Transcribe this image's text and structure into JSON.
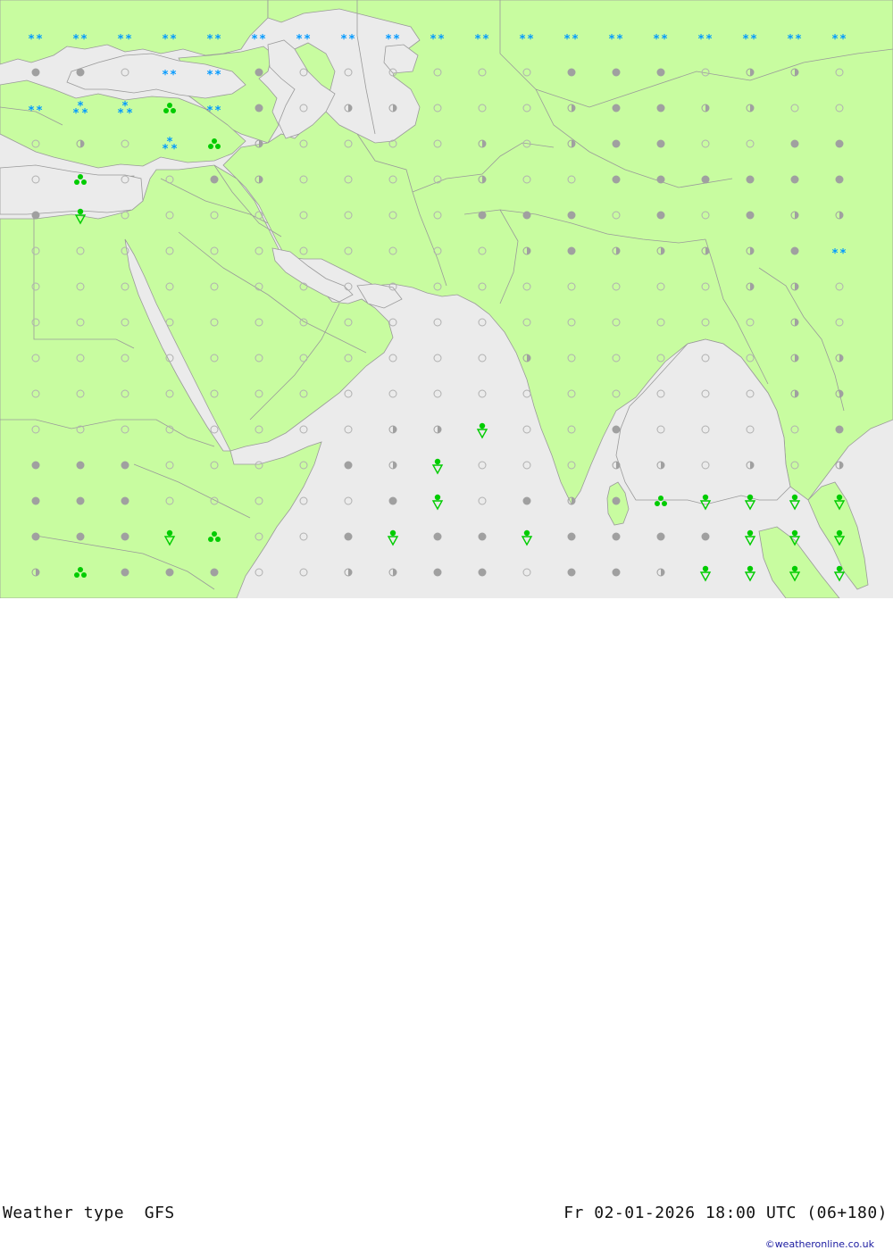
{
  "title": {
    "product": "Weather type",
    "model": "GFS",
    "datetime": "Fr 02-01-2026 18:00 UTC (06+180)"
  },
  "credit": "©weatheronline.co.uk",
  "colors": {
    "sea": "#ebebeb",
    "land": "#c8fca0",
    "border": "#9a9a9a",
    "dot_gray": "#a0a0a0",
    "rain_green": "#00cc00",
    "snow_blue": "#0099ff"
  },
  "symbols": {
    "column_x": [
      40,
      90,
      140,
      190,
      240,
      290,
      340,
      390,
      440,
      490,
      540,
      590,
      640,
      690,
      740,
      790,
      840,
      890,
      940
    ],
    "row_y": [
      41,
      81,
      121,
      161,
      201,
      241,
      281,
      321,
      361,
      401,
      441,
      481,
      521,
      561,
      601,
      641
    ],
    "grid": [
      "s.d.s.d.s.d.s.d.s.d.s.d.s.d.s.d.s.d.s.d.s.d.s.d.s.d.s.d.s.d.s.d.s.d.s.d.s.d",
      "d.d.o.s.s.d.o.o.o.o.o.o.d.d.d.o.h.h.o",
      "S.x.W.c.s.d.o.h.h.o.o.o.h.d.d.h.h.o.o",
      "o.h.o.W.c.h.o.o.o.o.h.o.h.d.d.o.o.d.d",
      "o.c.o.o.d.h.o.o.o.o.h.o.o.d.d.d.d.d.d",
      "d.r.o.o.o.o.o.o.o.o.d.d.d.o.d.o.d.h.h",
      "o.o.o.o.o.o.o.o.o.o.o.h.d.h.h.h.h.d.S",
      "o.o.o.o.o.o.o.o.o.o.o.o.o.o.o.o.h.h.o",
      "o.o.o.o.o.o.o.o.o.o.o.o.o.o.o.o.o.h.o",
      "o.o.o.o.o.o.o.o.o.o.o.h.o.o.o.o.o.h.h",
      "o.o.o.o.o.o.o.o.o.o.o.o.o.o.o.o.o.h.h",
      "o.o.o.o.o.o.o.o.h.h.r.o.o.d.o.o.o.o.d",
      "d.d.d.o.o.o.o.d.h.r.o.o.o.h.h.o.h.o.h",
      "d.d.d.o.o.o.o.o.d.r.o.d.h.d.c.r.r.r.r",
      "d.d.d.r.c.o.o.d.r.d.d.r.d.d.d.d.r.r.r",
      "h.c.d.d.d.o.o.h.h.d.d.o.d.d.h.r.r.r.r"
    ]
  }
}
